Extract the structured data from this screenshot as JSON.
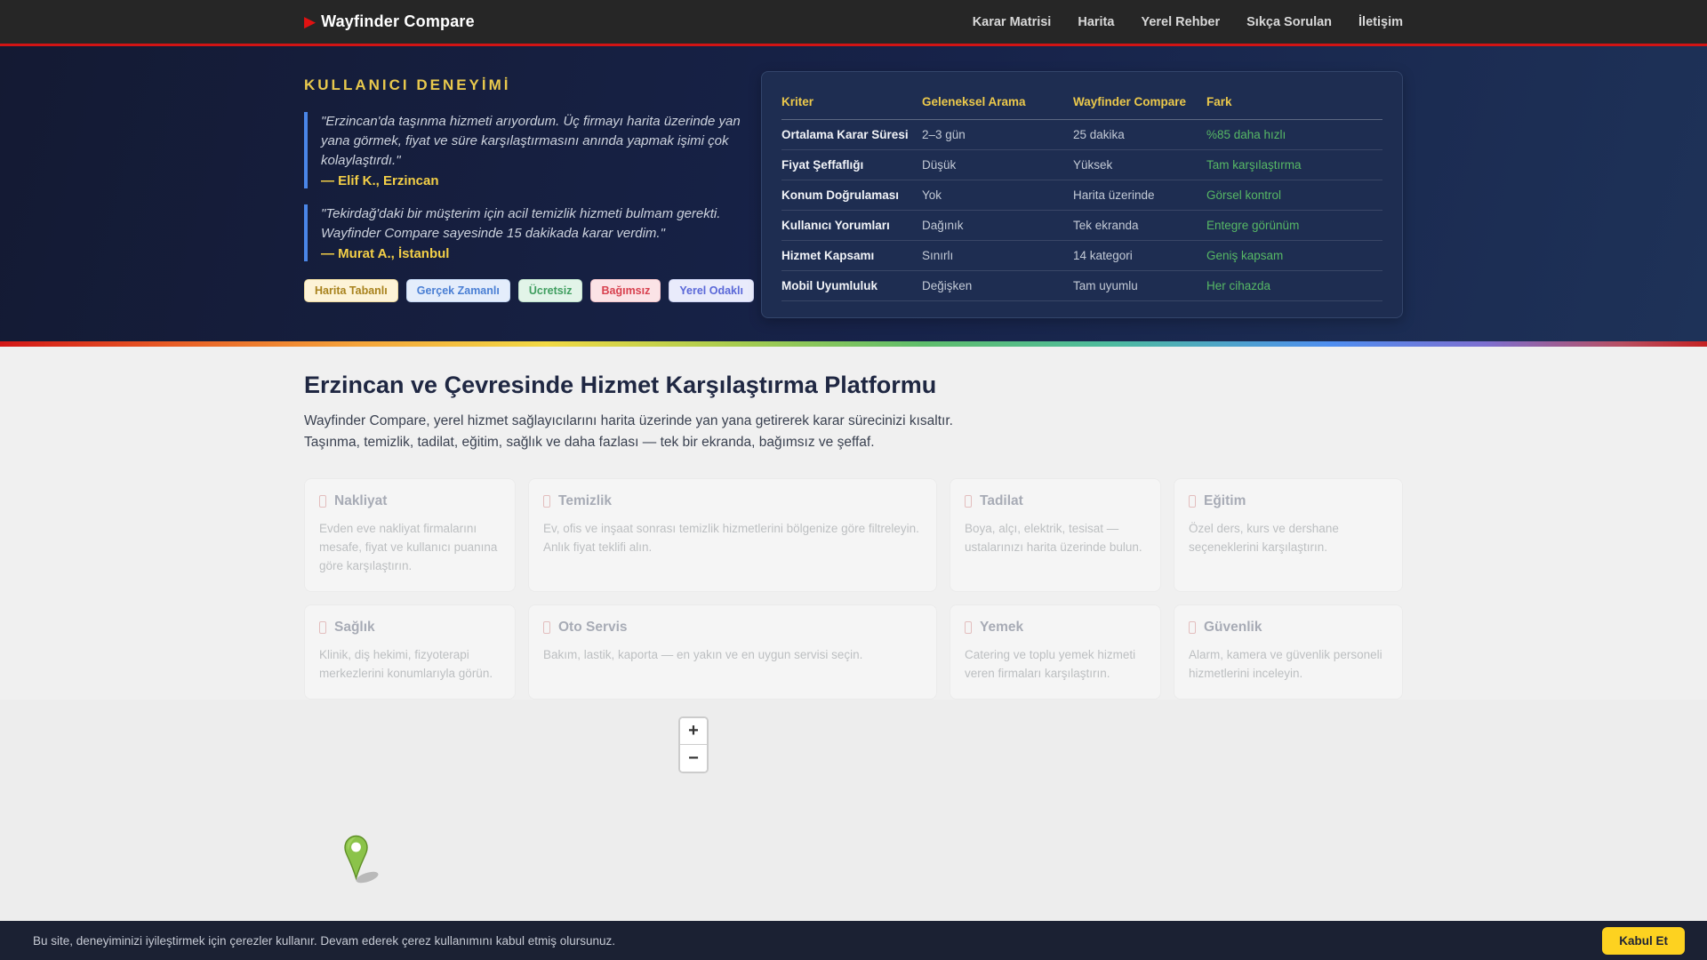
{
  "nav": {
    "brand": "Wayfinder Compare",
    "links": [
      {
        "label": "Karar Matrisi"
      },
      {
        "label": "Harita"
      },
      {
        "label": "Yerel Rehber"
      },
      {
        "label": "Sıkça Sorulan"
      },
      {
        "label": "İletişim"
      }
    ]
  },
  "hero": {
    "kicker": "KULLANICI DENEYİMİ",
    "testimonials": [
      {
        "quote": "\"Erzincan'da taşınma hizmeti arıyordum. Üç firmayı harita üzerinde yan yana görmek, fiyat ve süre karşılaştırmasını anında yapmak işimi çok kolaylaştırdı.\"",
        "author": "— Elif K., Erzincan"
      },
      {
        "quote": "\"Tekirdağ'daki bir müşterim için acil temizlik hizmeti bulmam gerekti. Wayfinder Compare sayesinde 15 dakikada karar verdim.\"",
        "author": "— Murat A., İstanbul"
      }
    ],
    "tags": [
      {
        "label": "Harita Tabanlı",
        "bg": "#fdf3d7",
        "color": "#a8821d",
        "border": "#ecd9a0"
      },
      {
        "label": "Gerçek Zamanlı",
        "bg": "#e4edfb",
        "color": "#4a7fd4",
        "border": "#c3d6f2"
      },
      {
        "label": "Ücretsiz",
        "bg": "#e2f4e8",
        "color": "#3f9e5f",
        "border": "#bfe3cc"
      },
      {
        "label": "Bağımsız",
        "bg": "#fbe3e6",
        "color": "#d8414f",
        "border": "#f2c4ca"
      },
      {
        "label": "Yerel Odaklı",
        "bg": "#e9ebfb",
        "color": "#5a68d8",
        "border": "#cdd2f2"
      }
    ],
    "comparison_table": {
      "headers": [
        "Kriter",
        "Geleneksel Arama",
        "Wayfinder Compare",
        "Fark"
      ],
      "rows": [
        [
          "Ortalama Karar Süresi",
          "2–3 gün",
          "25 dakika",
          "%85 daha hızlı"
        ],
        [
          "Fiyat Şeffaflığı",
          "Düşük",
          "Yüksek",
          "Tam karşılaştırma"
        ],
        [
          "Konum Doğrulaması",
          "Yok",
          "Harita üzerinde",
          "Görsel kontrol"
        ],
        [
          "Kullanıcı Yorumları",
          "Dağınık",
          "Tek ekranda",
          "Entegre görünüm"
        ],
        [
          "Hizmet Kapsamı",
          "Sınırlı",
          "14 kategori",
          "Geniş kapsam"
        ],
        [
          "Mobil Uyumluluk",
          "Değişken",
          "Tam uyumlu",
          "Her cihazda"
        ]
      ]
    }
  },
  "main": {
    "title": "Erzincan ve Çevresinde Hizmet Karşılaştırma Platformu",
    "intro_line1": "Wayfinder Compare, yerel hizmet sağlayıcılarını harita üzerinde yan yana getirerek karar sürecinizi kısaltır.",
    "intro_line2": "Taşınma, temizlik, tadilat, eğitim, sağlık ve daha fazlası — tek bir ekranda, bağımsız ve şeffaf.",
    "cards": [
      {
        "title": "Nakliyat",
        "description": "Evden eve nakliyat firmalarını mesafe, fiyat ve kullanıcı puanına göre karşılaştırın."
      },
      {
        "title": "Temizlik",
        "description": "Ev, ofis ve inşaat sonrası temizlik hizmetlerini bölgenize göre filtreleyin. Anlık fiyat teklifi alın."
      },
      {
        "title": "Tadilat",
        "description": "Boya, alçı, elektrik, tesisat — ustalarınızı harita üzerinde bulun."
      },
      {
        "title": "Eğitim",
        "description": "Özel ders, kurs ve dershane seçeneklerini karşılaştırın."
      },
      {
        "title": "Sağlık",
        "description": "Klinik, diş hekimi, fizyoterapi merkezlerini konumlarıyla görün."
      },
      {
        "title": "Oto Servis",
        "description": "Bakım, lastik, kaporta — en yakın ve en uygun servisi seçin."
      },
      {
        "title": "Yemek",
        "description": "Catering ve toplu yemek hizmeti veren firmaları karşılaştırın."
      },
      {
        "title": "Güvenlik",
        "description": "Alarm, kamera ve güvenlik personeli hizmetlerini inceleyin."
      }
    ]
  },
  "map": {
    "zoom_in_label": "+",
    "zoom_out_label": "−",
    "marker_color": "#8bc34a"
  },
  "cookie": {
    "message": "Bu site, deneyiminizi iyileştirmek için çerezler kullanır. Devam ederek çerez kullanımını kabul etmiş olursunuz.",
    "accept_label": "Kabul Et"
  },
  "colors": {
    "accent_red": "#d11414",
    "hero_navy": "#17234a",
    "heading_yellow": "#ecc94b",
    "positive_green": "#57b865",
    "testimonial_blue": "#4a86e8",
    "cookie_button_yellow": "#fdd220"
  }
}
